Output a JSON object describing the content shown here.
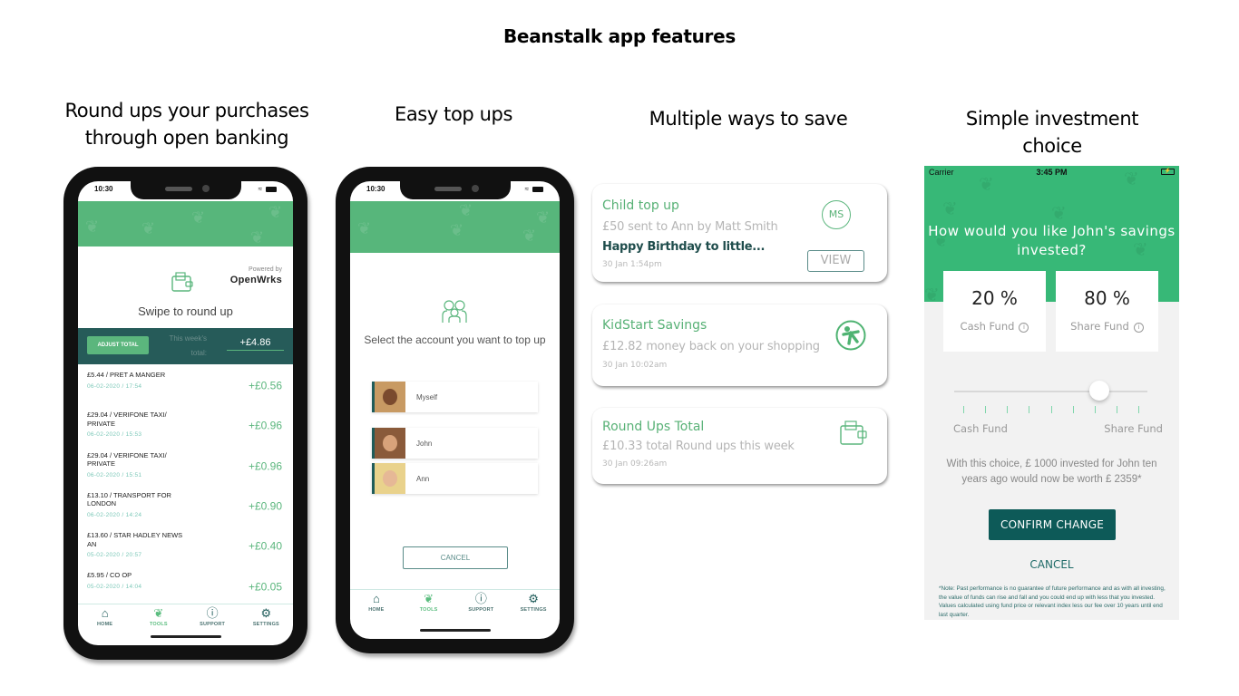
{
  "slide": {
    "title": "Beanstalk app features",
    "captions": [
      "Round ups your purchases through open banking",
      "Easy top ups",
      "Multiple ways to save",
      "Simple investment choice"
    ]
  },
  "colors": {
    "brand_green": "#57b67b",
    "dark_teal": "#265b59",
    "confirm_teal": "#0d5a58",
    "invest_green": "#37b877"
  },
  "roundups_screen": {
    "status_time": "10:30",
    "icons": [
      "wifi-icon",
      "battery-icon",
      "wallet-icon"
    ],
    "powered_by": "Powered by",
    "powered_brand": "OpenWrks",
    "swipe_text": "Swipe to round up",
    "adjust_button": "ADJUST TOTAL",
    "week_total_label": "This week's total:",
    "week_total_value": "+£4.86",
    "transactions": [
      {
        "description": "£5.44 / PRET A MANGER",
        "date": "06-02-2020 / 17:54",
        "roundup": "+£0.56"
      },
      {
        "description": "£29.04 / VERIFONE TAXI/ PRIVATE",
        "date": "06-02-2020 / 15:53",
        "roundup": "+£0.96"
      },
      {
        "description": "£29.04 / VERIFONE TAXI/ PRIVATE",
        "date": "06-02-2020 / 15:51",
        "roundup": "+£0.96"
      },
      {
        "description": "£13.10 / TRANSPORT FOR LONDON",
        "date": "06-02-2020 / 14:24",
        "roundup": "+£0.90"
      },
      {
        "description": "£13.60 / STAR HADLEY NEWS AN",
        "date": "05-02-2020 / 20:57",
        "roundup": "+£0.40"
      },
      {
        "description": "£5.95 / CO OP",
        "date": "05-02-2020 / 14:04",
        "roundup": "+£0.05"
      }
    ],
    "tabs": [
      {
        "label": "HOME",
        "icon": "home-icon",
        "active": false
      },
      {
        "label": "TOOLS",
        "icon": "leaf-icon",
        "active": true
      },
      {
        "label": "SUPPORT",
        "icon": "help-icon",
        "active": false
      },
      {
        "label": "SETTINGS",
        "icon": "gear-icon",
        "active": false
      }
    ]
  },
  "topup_screen": {
    "status_time": "10:30",
    "prompt": "Select the account you want to top up",
    "accounts": [
      {
        "name": "Myself"
      },
      {
        "name": "John"
      },
      {
        "name": "Ann"
      }
    ],
    "cancel_button": "CANCEL",
    "tabs": [
      {
        "label": "HOME",
        "icon": "home-icon",
        "active": false
      },
      {
        "label": "TOOLS",
        "icon": "leaf-icon",
        "active": true
      },
      {
        "label": "SUPPORT",
        "icon": "help-icon",
        "active": false
      },
      {
        "label": "SETTINGS",
        "icon": "gear-icon",
        "active": false
      }
    ]
  },
  "save_cards": [
    {
      "title": "Child top up",
      "subtitle": "£50 sent to Ann by Matt Smith",
      "message": "Happy Birthday to little...",
      "time": "30 Jan 1:54pm",
      "badge": "MS",
      "button": "VIEW"
    },
    {
      "title": "KidStart Savings",
      "subtitle": "£12.82 money back on your shopping",
      "time": "30 Jan 10:02am",
      "icon": "kidstart-icon"
    },
    {
      "title": "Round Ups Total",
      "subtitle": "£10.33 total Round ups this week",
      "time": "30 Jan 09:26am",
      "icon": "wallet-icon"
    }
  ],
  "invest_screen": {
    "carrier": "Carrier",
    "time": "3:45 PM",
    "question": "How would you like John's savings invested?",
    "cash_fund": {
      "percent": "20 %",
      "label": "Cash Fund"
    },
    "share_fund": {
      "percent": "80 %",
      "label": "Share Fund"
    },
    "slider": {
      "value_fraction": 0.75,
      "ticks": 9,
      "min_label": "Cash Fund",
      "max_label": "Share Fund"
    },
    "worth_text": "With this choice,  £ 1000 invested for John ten years ago would now be worth  £ 2359*",
    "confirm_button": "CONFIRM CHANGE",
    "cancel_button": "CANCEL",
    "note": "*Note: Past performance is no guarantee of future performance and as with all investing, the value of funds can rise and fall and you could end up with less that you invested. Values calculated using fund price or relevant index less our fee over 10 years until end last quarter."
  }
}
